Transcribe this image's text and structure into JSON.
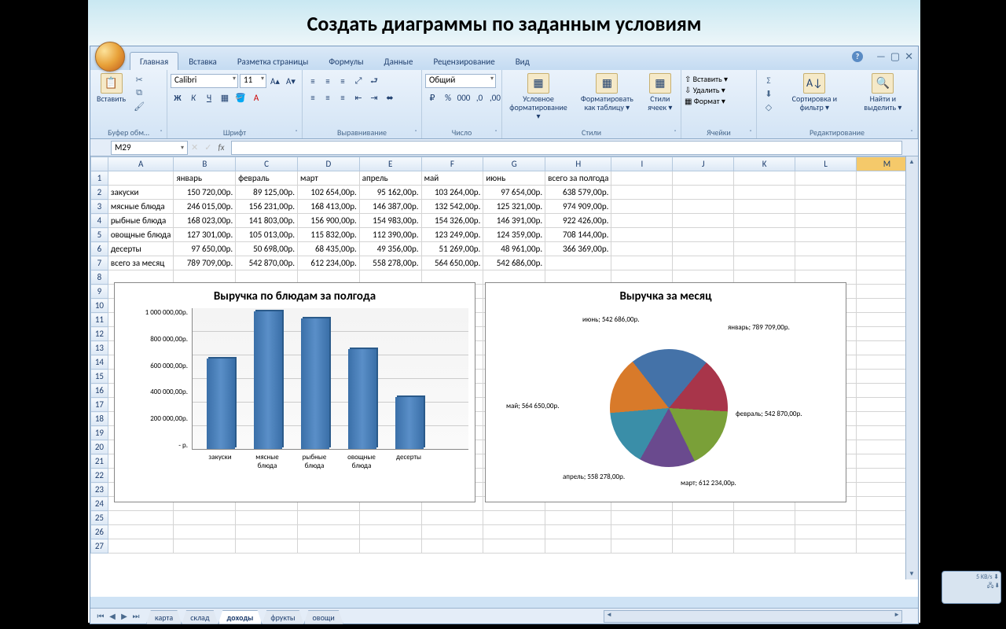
{
  "slide_title": "Создать диаграммы по заданным условиям",
  "ribbon": {
    "tabs": [
      "Главная",
      "Вставка",
      "Разметка страницы",
      "Формулы",
      "Данные",
      "Рецензирование",
      "Вид"
    ],
    "active_tab": "Главная",
    "paste": "Вставить",
    "clipboard_label": "Буфер обм…",
    "font_name": "Calibri",
    "font_size": "11",
    "font_label": "Шрифт",
    "align_label": "Выравнивание",
    "number_format": "Общий",
    "number_label": "Число",
    "cond_fmt": "Условное форматирование ▾",
    "fmt_table": "Форматировать как таблицу ▾",
    "cell_styles": "Стили ячеек ▾",
    "styles_label": "Стили",
    "insert": "Вставить ▾",
    "delete": "Удалить ▾",
    "format": "Формат ▾",
    "cells_label": "Ячейки",
    "sort": "Сортировка и фильтр ▾",
    "find": "Найти и выделить ▾",
    "editing_label": "Редактирование"
  },
  "name_box": "M29",
  "columns": [
    "A",
    "B",
    "C",
    "D",
    "E",
    "F",
    "G",
    "H",
    "I",
    "J",
    "K",
    "L",
    "M"
  ],
  "row_headers": [
    "",
    "январь",
    "февраль",
    "март",
    "апрель",
    "май",
    "июнь",
    "всего за полгода"
  ],
  "rows": [
    {
      "label": "закуски",
      "vals": [
        "150 720,00р.",
        "89 125,00р.",
        "102 654,00р.",
        "95 162,00р.",
        "103 264,00р.",
        "97 654,00р.",
        "638 579,00р."
      ]
    },
    {
      "label": "мясные блюда",
      "vals": [
        "246 015,00р.",
        "156 231,00р.",
        "168 413,00р.",
        "146 387,00р.",
        "132 542,00р.",
        "125 321,00р.",
        "974 909,00р."
      ]
    },
    {
      "label": "рыбные блюда",
      "vals": [
        "168 023,00р.",
        "141 803,00р.",
        "156 900,00р.",
        "154 983,00р.",
        "154 326,00р.",
        "146 391,00р.",
        "922 426,00р."
      ]
    },
    {
      "label": "овощные блюда",
      "vals": [
        "127 301,00р.",
        "105 013,00р.",
        "115 832,00р.",
        "112 390,00р.",
        "123 249,00р.",
        "124 359,00р.",
        "708 144,00р."
      ]
    },
    {
      "label": "десерты",
      "vals": [
        "97 650,00р.",
        "50 698,00р.",
        "68 435,00р.",
        "49 356,00р.",
        "51 269,00р.",
        "48 961,00р.",
        "366 369,00р."
      ]
    },
    {
      "label": "всего за месяц",
      "vals": [
        "789 709,00р.",
        "542 870,00р.",
        "612 234,00р.",
        "558 278,00р.",
        "564 650,00р.",
        "542 686,00р.",
        ""
      ]
    }
  ],
  "sheet_tabs": [
    "карта",
    "склад",
    "доходы",
    "фрукты",
    "овощи"
  ],
  "active_sheet": "доходы",
  "net_speed": "5 KB/s",
  "chart_data": [
    {
      "type": "bar",
      "title": "Выручка по блюдам за полгода",
      "categories": [
        "закуски",
        "мясные блюда",
        "рыбные блюда",
        "овощные блюда",
        "десерты"
      ],
      "values": [
        638579,
        974909,
        922426,
        708144,
        366369
      ],
      "ylabels": [
        "1 000 000,00р.",
        "800 000,00р.",
        "600 000,00р.",
        "400 000,00р.",
        "200 000,00р.",
        "- р."
      ],
      "ylim": [
        0,
        1000000
      ]
    },
    {
      "type": "pie",
      "title": "Выручка за месяц",
      "series": [
        {
          "name": "январь",
          "value": 789709,
          "label": "январь; 789 709,00р.",
          "color": "#4472a8"
        },
        {
          "name": "февраль",
          "value": 542870,
          "label": "февраль; 542 870,00р.",
          "color": "#a8354a"
        },
        {
          "name": "март",
          "value": 612234,
          "label": "март; 612 234,00р.",
          "color": "#7aa038"
        },
        {
          "name": "апрель",
          "value": 558278,
          "label": "апрель; 558 278,00р.",
          "color": "#6a4a8e"
        },
        {
          "name": "май",
          "value": 564650,
          "label": "май; 564 650,00р.",
          "color": "#3a8ea8"
        },
        {
          "name": "июнь",
          "value": 542686,
          "label": "июнь; 542 686,00р.",
          "color": "#d87a2a"
        }
      ]
    }
  ]
}
